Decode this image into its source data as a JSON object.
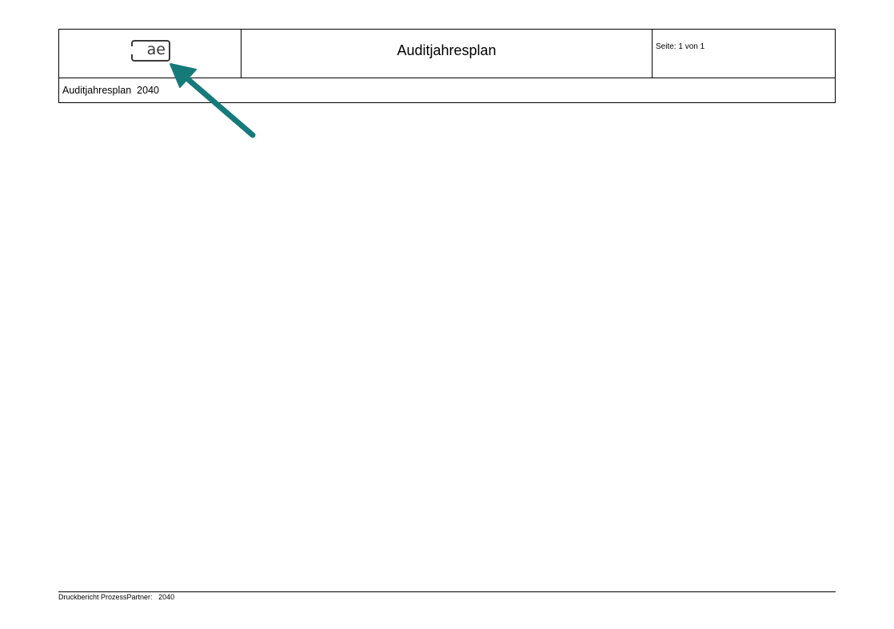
{
  "header": {
    "logo_text": "ae",
    "title": "Auditjahresplan",
    "page_info": "Seite: 1 von 1"
  },
  "subtitle": {
    "label": "Auditjahresplan",
    "year": "2040"
  },
  "footer": {
    "label": "Druckbericht ProzessPartner:",
    "year": "2040"
  },
  "annotation": {
    "arrow_color": "#167a7a",
    "icon": "arrow-pointer-icon"
  }
}
